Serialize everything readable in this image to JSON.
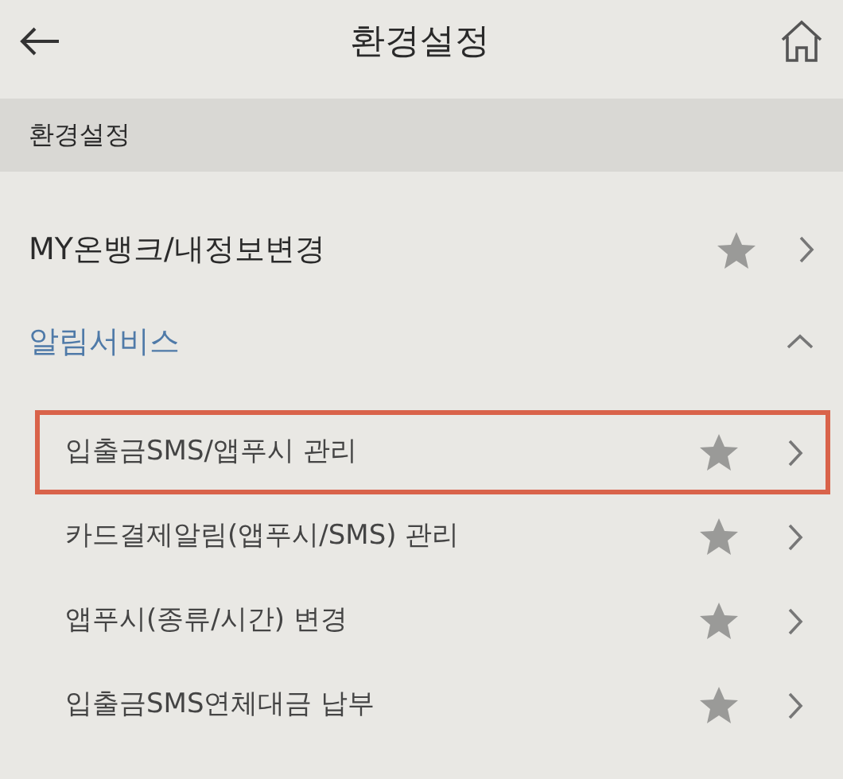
{
  "header": {
    "title": "환경설정"
  },
  "section_header": "환경설정",
  "items": [
    {
      "kind": "link",
      "label": "MY온뱅크/내정보변경"
    },
    {
      "kind": "group",
      "label": "알림서비스",
      "expanded": true,
      "children": [
        {
          "label": "입출금SMS/앱푸시 관리",
          "highlighted": true
        },
        {
          "label": "카드결제알림(앱푸시/SMS) 관리",
          "highlighted": false
        },
        {
          "label": "앱푸시(종류/시간) 변경",
          "highlighted": false
        },
        {
          "label": "입출금SMS연체대금 납부",
          "highlighted": false
        }
      ]
    }
  ]
}
